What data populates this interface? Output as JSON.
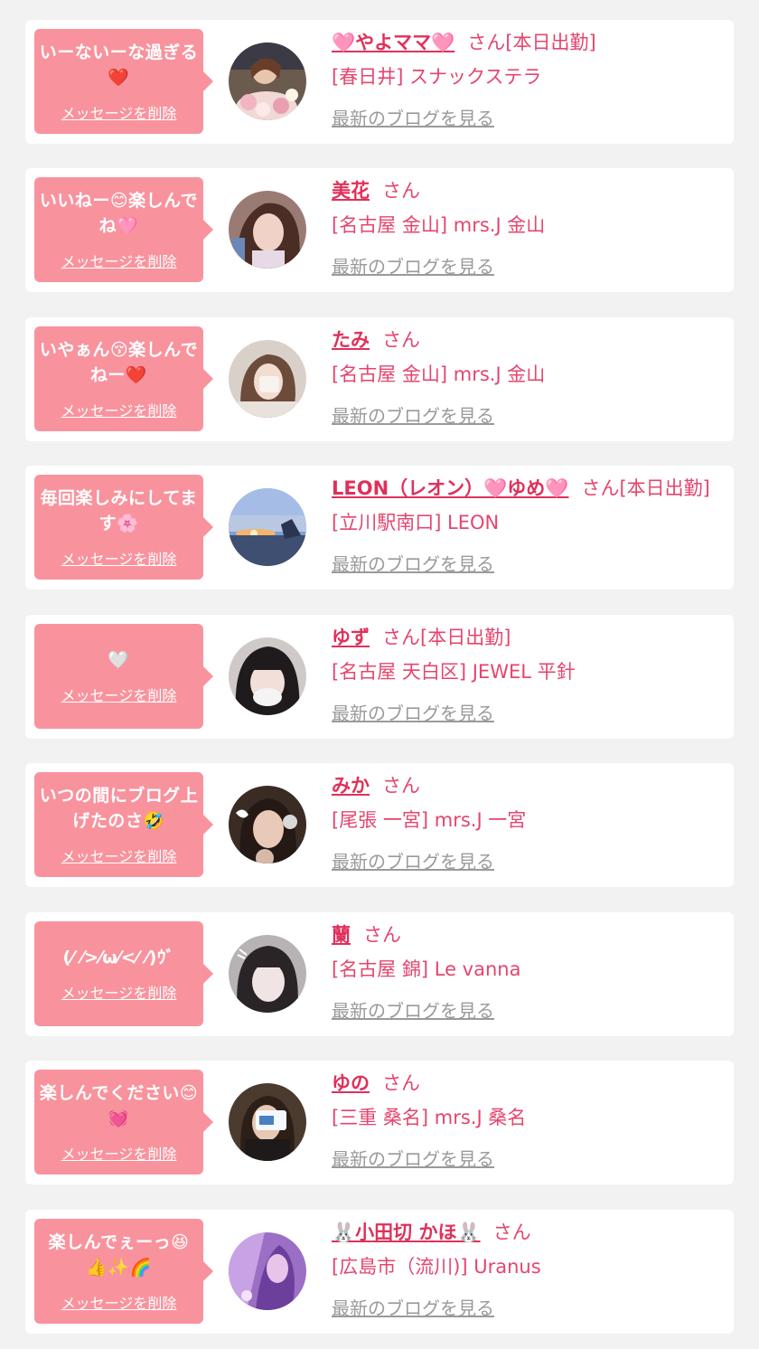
{
  "colors": {
    "background": "#f2f2f2",
    "card": "#ffffff",
    "bubble": "#f8939e",
    "accent_text": "#e5456e",
    "link_grey": "#9a9a9a"
  },
  "cards": [
    {
      "message": "いーないーな過ぎる❤️",
      "delete_label": "メッセージを削除",
      "name": "🩷やよママ🩷",
      "honorific": "さん[本日出勤]",
      "shop": "[春日井] スナックステラ",
      "blog_link": "最新のブログを見る",
      "avatar_icon": "avatar-photo"
    },
    {
      "message": "いいねー😊楽しんでね🩷",
      "delete_label": "メッセージを削除",
      "name": "美花",
      "honorific": "さん",
      "shop": "[名古屋 金山] mrs.J 金山",
      "blog_link": "最新のブログを見る",
      "avatar_icon": "avatar-photo"
    },
    {
      "message": "いやぁん😚楽しんでねー❤️",
      "delete_label": "メッセージを削除",
      "name": "たみ",
      "honorific": "さん",
      "shop": "[名古屋 金山] mrs.J 金山",
      "blog_link": "最新のブログを見る",
      "avatar_icon": "avatar-photo"
    },
    {
      "message": "毎回楽しみにしてます🌸",
      "delete_label": "メッセージを削除",
      "name": "LEON（レオン）🩷ゆめ🩷",
      "honorific": "さん[本日出勤]",
      "shop": "[立川駅南口] LEON",
      "blog_link": "最新のブログを見る",
      "avatar_icon": "avatar-photo"
    },
    {
      "message": "🤍",
      "delete_label": "メッセージを削除",
      "name": "ゆず",
      "honorific": "さん[本日出勤]",
      "shop": "[名古屋 天白区] JEWEL 平針",
      "blog_link": "最新のブログを見る",
      "avatar_icon": "avatar-photo"
    },
    {
      "message": "いつの間にブログ上げたのさ🤣",
      "delete_label": "メッセージを削除",
      "name": "みか",
      "honorific": "さん",
      "shop": "[尾張 一宮] mrs.J 一宮",
      "blog_link": "最新のブログを見る",
      "avatar_icon": "avatar-photo"
    },
    {
      "message": "(⁄ ⁄>⁄ω⁄<⁄ ⁄)ｳﾞ",
      "delete_label": "メッセージを削除",
      "name": "蘭",
      "honorific": "さん",
      "shop": "[名古屋 錦] Le vanna",
      "blog_link": "最新のブログを見る",
      "avatar_icon": "avatar-photo"
    },
    {
      "message": "楽しんでください😊💓",
      "delete_label": "メッセージを削除",
      "name": "ゆの",
      "honorific": "さん",
      "shop": "[三重 桑名] mrs.J 桑名",
      "blog_link": "最新のブログを見る",
      "avatar_icon": "avatar-photo"
    },
    {
      "message": "楽しんでぇーっ😆👍✨🌈",
      "delete_label": "メッセージを削除",
      "name": "🐰小田切 かほ🐰",
      "honorific": "さん",
      "shop": "[広島市（流川)] Uranus",
      "blog_link": "最新のブログを見る",
      "avatar_icon": "avatar-photo"
    }
  ]
}
